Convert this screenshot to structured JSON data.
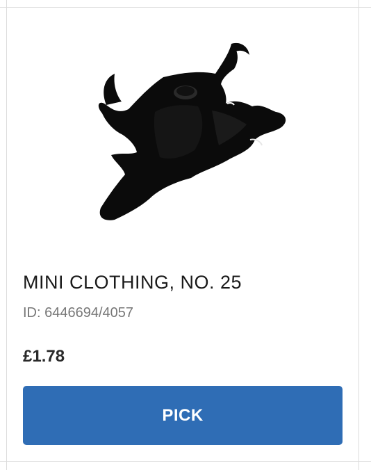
{
  "product": {
    "name": "MINI CLOTHING, NO. 25",
    "id_text": "ID: 6446694/4057",
    "price": "£1.78",
    "image_icon": "minifigure-cape-piece",
    "image_color": "#0a0a0a"
  },
  "actions": {
    "pick_label": "PICK",
    "pick_color": "#2f6db5"
  }
}
